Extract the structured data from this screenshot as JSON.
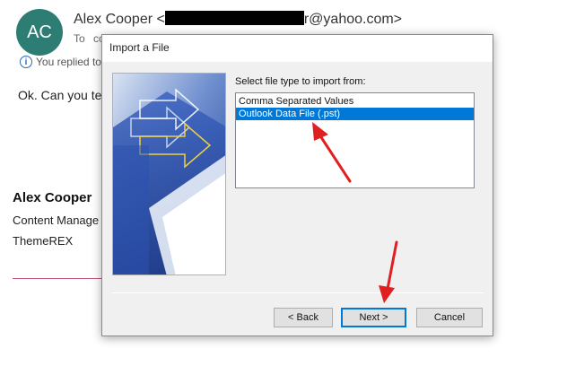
{
  "email": {
    "avatar_initials": "AC",
    "sender_name": "Alex Cooper <",
    "sender_domain": "r@yahoo.com>",
    "to_label": "To",
    "to_value": "co",
    "replied_notice": "You replied to",
    "body_text": "Ok. Can you tell",
    "signature": {
      "name": "Alex Cooper",
      "title": "Content Manage",
      "company": "ThemeREX"
    }
  },
  "dialog": {
    "title": "Import a File",
    "prompt": "Select file type to import from:",
    "file_types": [
      {
        "label": "Comma Separated Values",
        "selected": false
      },
      {
        "label": "Outlook Data File (.pst)",
        "selected": true
      }
    ],
    "buttons": {
      "back": "< Back",
      "next": "Next >",
      "cancel": "Cancel"
    }
  },
  "colors": {
    "avatar_bg": "#2e7d75",
    "selection": "#0078d7",
    "annotation_arrow": "#e02020"
  }
}
